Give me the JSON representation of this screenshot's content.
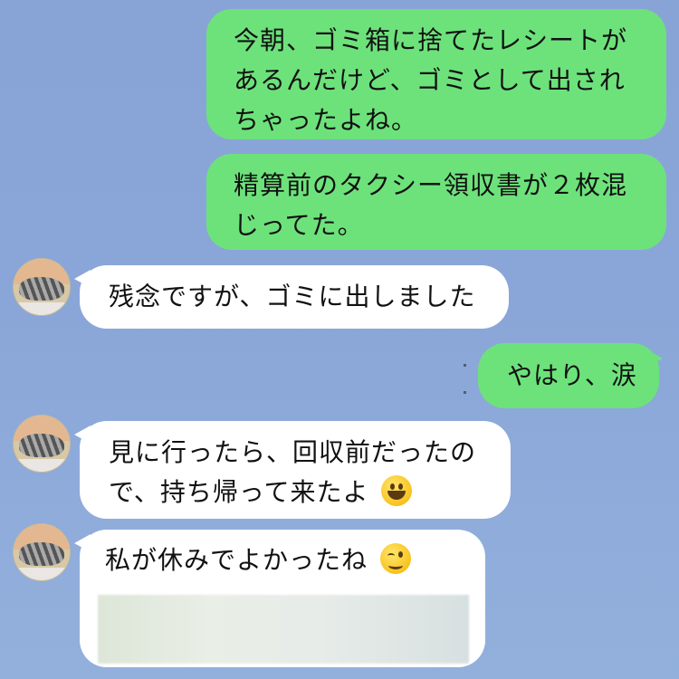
{
  "messages": [
    {
      "id": "m1",
      "direction": "out",
      "lines": [
        "今朝、ゴミ箱に捨てたレシートが",
        "あるんだけど、ゴミとして出され",
        "ちゃったよね。"
      ]
    },
    {
      "id": "m2",
      "direction": "out",
      "lines": [
        "精算前のタクシー領収書が２枚混",
        "じってた。"
      ]
    },
    {
      "id": "m3",
      "direction": "in",
      "lines": [
        "残念ですが、ゴミに出しました"
      ]
    },
    {
      "id": "m4",
      "direction": "out",
      "lines": [
        "やはり、涙"
      ]
    },
    {
      "id": "m5",
      "direction": "in",
      "lines": [
        "見に行ったら、回収前だったの",
        "で、持ち帰って来たよ"
      ],
      "emoji": "grinning-face"
    },
    {
      "id": "m6",
      "direction": "in",
      "lines": [
        "私が休みでよかったね"
      ],
      "emoji": "winking-face",
      "attachment": "blurred-image"
    }
  ],
  "colors": {
    "background": "#8aa6d8",
    "outgoing_bubble": "#6de27b",
    "incoming_bubble": "#ffffff"
  }
}
